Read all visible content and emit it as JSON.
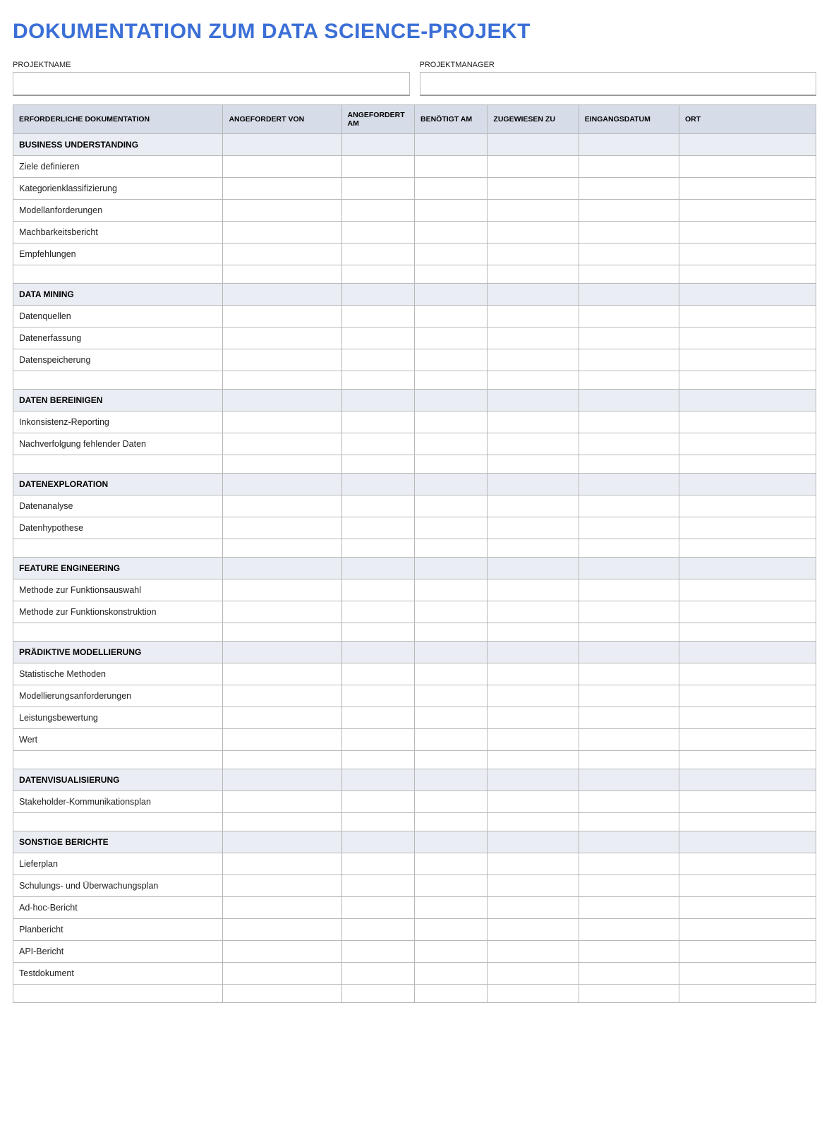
{
  "title": "DOKUMENTATION ZUM DATA SCIENCE-PROJEKT",
  "meta": {
    "project_name_label": "PROJEKTNAME",
    "project_name_value": "",
    "project_manager_label": "PROJEKTMANAGER",
    "project_manager_value": ""
  },
  "columns": [
    "ERFORDERLICHE DOKUMENTATION",
    "ANGEFORDERT VON",
    "ANGEFORDERT AM",
    "BENÖTIGT AM",
    "ZUGEWIESEN ZU",
    "EINGANGSDATUM",
    "ORT"
  ],
  "sections": [
    {
      "heading": "BUSINESS UNDERSTANDING",
      "items": [
        "Ziele definieren",
        "Kategorienklassifizierung",
        "Modellanforderungen",
        "Machbarkeitsbericht",
        "Empfehlungen"
      ]
    },
    {
      "heading": "DATA MINING",
      "items": [
        "Datenquellen",
        "Datenerfassung",
        "Datenspeicherung"
      ]
    },
    {
      "heading": "DATEN BEREINIGEN",
      "items": [
        "Inkonsistenz-Reporting",
        "Nachverfolgung fehlender Daten"
      ]
    },
    {
      "heading": "DATENEXPLORATION",
      "items": [
        "Datenanalyse",
        "Datenhypothese"
      ]
    },
    {
      "heading": "FEATURE ENGINEERING",
      "items": [
        "Methode zur Funktionsauswahl",
        "Methode zur Funktionskonstruktion"
      ]
    },
    {
      "heading": "PRÄDIKTIVE MODELLIERUNG",
      "items": [
        "Statistische Methoden",
        "Modellierungsanforderungen",
        "Leistungsbewertung",
        "Wert"
      ]
    },
    {
      "heading": "DATENVISUALISIERUNG",
      "items": [
        "Stakeholder-Kommunikationsplan"
      ]
    },
    {
      "heading": "SONSTIGE BERICHTE",
      "items": [
        "Lieferplan",
        "Schulungs- und Überwachungsplan",
        "Ad-hoc-Bericht",
        "Planbericht",
        "API-Bericht",
        "Testdokument"
      ]
    }
  ]
}
